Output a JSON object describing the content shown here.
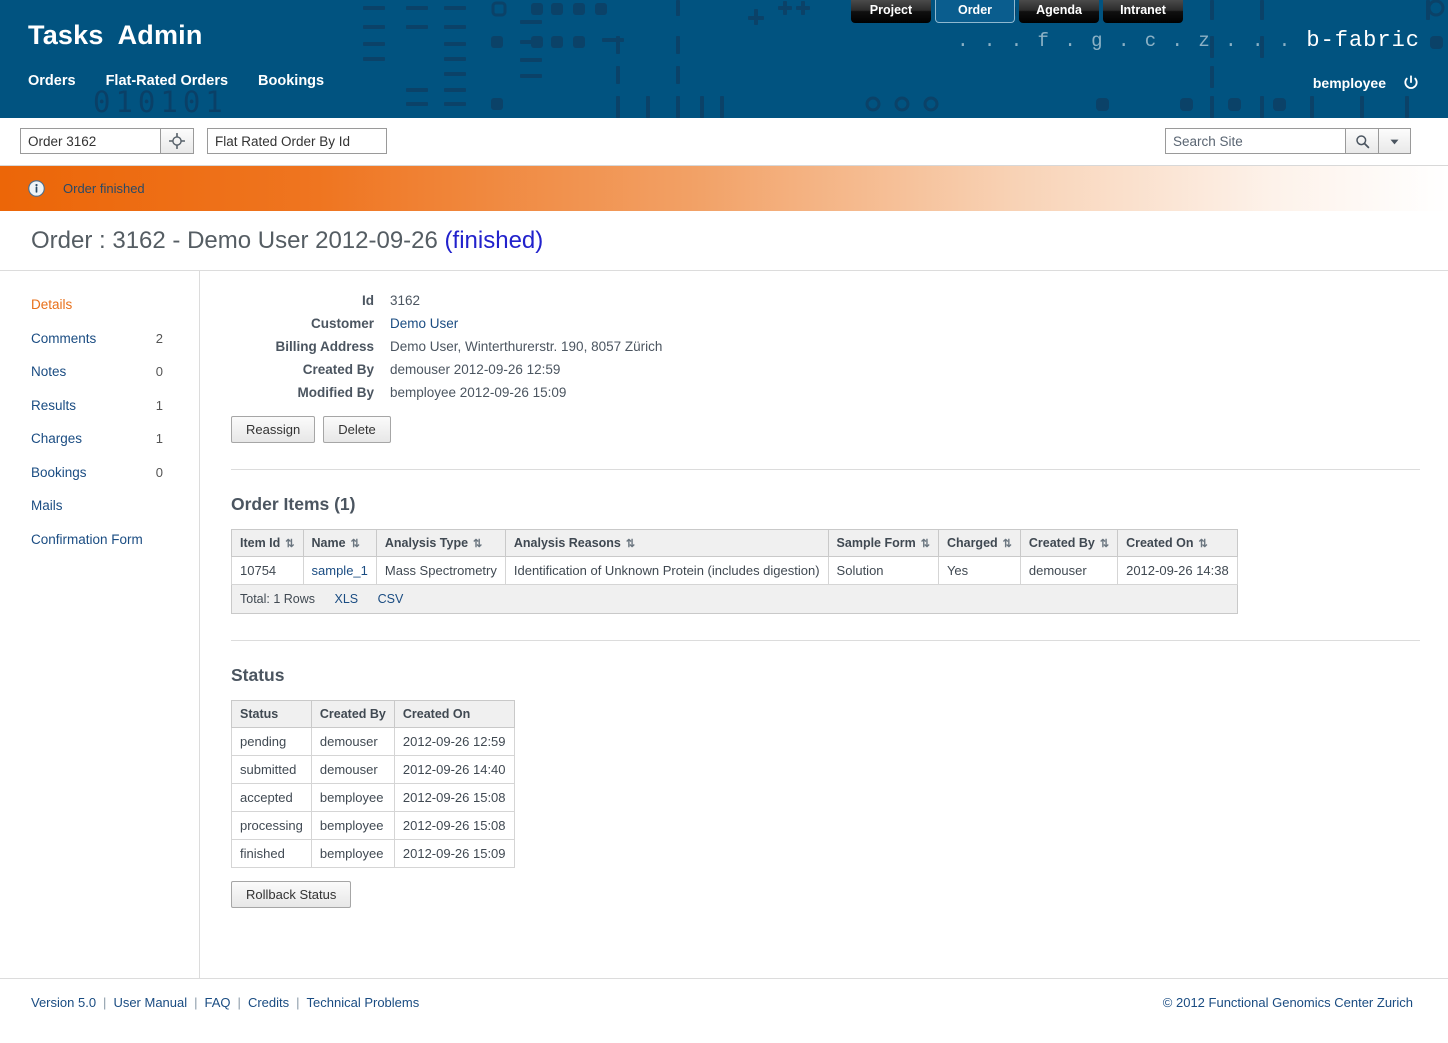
{
  "header": {
    "app_title_1": "Tasks",
    "app_title_2": "Admin",
    "nav": [
      {
        "label": "Orders"
      },
      {
        "label": "Flat-Rated Orders"
      },
      {
        "label": "Bookings"
      }
    ],
    "tabs": [
      {
        "label": "Project",
        "active": false
      },
      {
        "label": "Order",
        "active": true
      },
      {
        "label": "Agenda",
        "active": false
      },
      {
        "label": "Intranet",
        "active": false
      }
    ],
    "brand_dots": ". . . f . g . c . z . . .",
    "brand_name": "b-fabric",
    "username": "bemployee",
    "logout_icon": "power-icon",
    "bg_color": "#015380"
  },
  "searchbar": {
    "order_value": "Order 3162",
    "order_placeholder": "Order 3162",
    "target_icon": "crosshair-icon",
    "flat_value": "Flat Rated Order By Id",
    "flat_placeholder": "Flat Rated Order By Id",
    "site_search_value": "Search Site",
    "site_search_placeholder": "Search Site",
    "search_icon": "search-icon",
    "dropdown_icon": "chevron-down-icon"
  },
  "notice": {
    "icon": "info-icon",
    "text": "Order finished",
    "accent": "#ec6608"
  },
  "page": {
    "title": "Order : 3162 - Demo User 2012-09-26",
    "status": "(finished)",
    "status_color": "#2222cc"
  },
  "sidebar": {
    "items": [
      {
        "label": "Details",
        "count": "",
        "active": true
      },
      {
        "label": "Comments",
        "count": "2",
        "active": false
      },
      {
        "label": "Notes",
        "count": "0",
        "active": false
      },
      {
        "label": "Results",
        "count": "1",
        "active": false
      },
      {
        "label": "Charges",
        "count": "1",
        "active": false
      },
      {
        "label": "Bookings",
        "count": "0",
        "active": false
      },
      {
        "label": "Mails",
        "count": "",
        "active": false
      },
      {
        "label": "Confirmation Form",
        "count": "",
        "active": false
      }
    ],
    "active_color": "#e8701a"
  },
  "details": {
    "rows": [
      {
        "key": "Id",
        "value": "3162",
        "link": false
      },
      {
        "key": "Customer",
        "value": "Demo User",
        "link": true
      },
      {
        "key": "Billing Address",
        "value": "Demo User, Winterthurerstr. 190, 8057 Zürich",
        "link": false
      },
      {
        "key": "Created By",
        "value": "demouser 2012-09-26 12:59",
        "link": false
      },
      {
        "key": "Modified By",
        "value": "bemployee 2012-09-26 15:09",
        "link": false
      }
    ],
    "buttons": [
      {
        "label": "Reassign"
      },
      {
        "label": "Delete"
      }
    ]
  },
  "order_items": {
    "title": "Order Items (1)",
    "columns": [
      "Item Id",
      "Name",
      "Analysis Type",
      "Analysis Reasons",
      "Sample Form",
      "Charged",
      "Created By",
      "Created On"
    ],
    "sort_glyph": "≡",
    "rows": [
      {
        "item_id": "10754",
        "name": "sample_1",
        "analysis_type": "Mass Spectrometry",
        "analysis_reasons": "Identification of Unknown Protein (includes digestion)",
        "sample_form": "Solution",
        "charged": "Yes",
        "created_by": "demouser",
        "created_on": "2012-09-26 14:38"
      }
    ],
    "footer_total": "Total: 1 Rows",
    "export_xls": "XLS",
    "export_csv": "CSV"
  },
  "status_section": {
    "title": "Status",
    "columns": [
      "Status",
      "Created By",
      "Created On"
    ],
    "rows": [
      {
        "status": "pending",
        "created_by": "demouser",
        "created_on": "2012-09-26 12:59",
        "color": "#f0a02a"
      },
      {
        "status": "submitted",
        "created_by": "demouser",
        "created_on": "2012-09-26 14:40",
        "color": "#b07a10"
      },
      {
        "status": "accepted",
        "created_by": "bemployee",
        "created_on": "2012-09-26 15:08",
        "color": "#2a8a2a"
      },
      {
        "status": "processing",
        "created_by": "bemployee",
        "created_on": "2012-09-26 15:08",
        "color": "#3a9ae0"
      },
      {
        "status": "finished",
        "created_by": "bemployee",
        "created_on": "2012-09-26 15:09",
        "color": "#2222cc"
      }
    ],
    "rollback_button": "Rollback Status"
  },
  "footer": {
    "version": "Version 5.0",
    "links": [
      {
        "label": "User Manual"
      },
      {
        "label": "FAQ"
      },
      {
        "label": "Credits"
      },
      {
        "label": "Technical Problems"
      }
    ],
    "separator": "|",
    "copyright": "© 2012 Functional Genomics Center Zurich"
  }
}
